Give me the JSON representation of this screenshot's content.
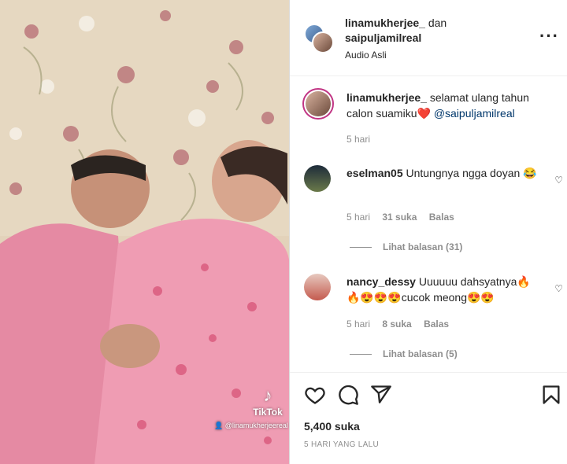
{
  "header": {
    "user1": "linamukherjee_",
    "joiner": "dan",
    "user2": "saipuljamilreal",
    "audio": "Audio Asli",
    "more_icon": "more-horizontal-icon"
  },
  "video": {
    "watermark_brand": "TikTok",
    "watermark_user": "@linamukherjeereal"
  },
  "comments": [
    {
      "user": "linamukherjee_",
      "text": "selamat ulang tahun calon suamiku❤️",
      "mention": "@saipuljamilreal",
      "time": "5 hari"
    },
    {
      "user": "eselman05",
      "text": "Untungnya ngga doyan 😂",
      "time": "5 hari",
      "likes": "31 suka",
      "reply": "Balas",
      "view_replies": "Lihat balasan (31)"
    },
    {
      "user": "nancy_dessy",
      "text": "Uuuuuu dahsyatnya🔥🔥😍😍😍cucok meong😍😍",
      "time": "5 hari",
      "likes": "8 suka",
      "reply": "Balas",
      "view_replies": "Lihat balasan (5)"
    }
  ],
  "actions": {
    "likes": "5,400 suka",
    "date": "5 HARI YANG LALU",
    "icons": [
      "heart-icon",
      "comment-icon",
      "share-icon",
      "bookmark-icon"
    ]
  }
}
